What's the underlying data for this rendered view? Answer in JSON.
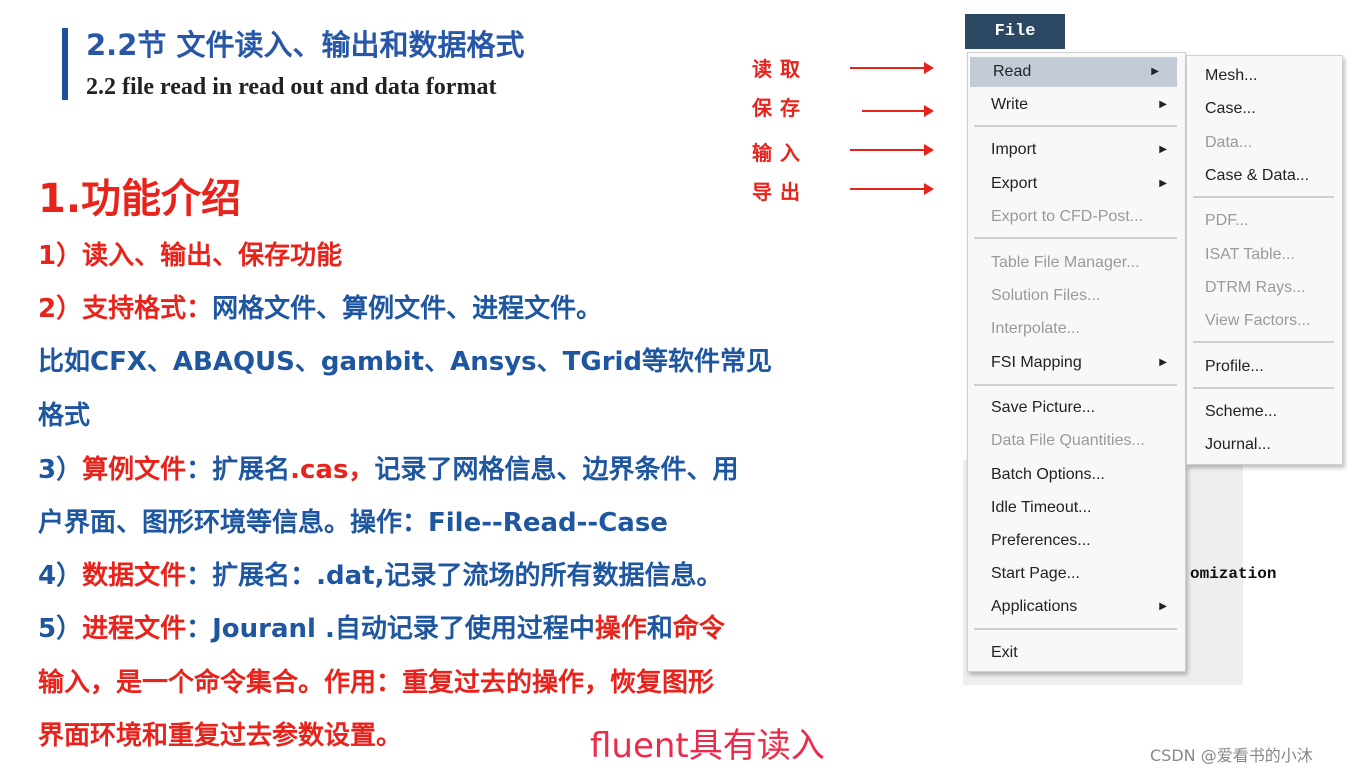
{
  "slide": {
    "title": "2.2节 文件读入、输出和数据格式",
    "subtitle": "2.2  file read in read out and data format",
    "heading": "1.功能介绍",
    "lines": [
      [
        "1）读入、输出、保存功能"
      ],
      [
        "2）支持格式：",
        "网格文件、算例文件、进程文件。"
      ],
      [
        "比如CFX、ABAQUS、gambit、Ansys、TGrid等软件常见"
      ],
      [
        "格式"
      ],
      [
        "3）",
        "算例文件",
        "：扩展名",
        ".cas，",
        "记录了网格信息、边界条件、用"
      ],
      [
        "户界面、图形环境等信息。操作：File--Read--Case"
      ],
      [
        "4）",
        "数据文件",
        "：扩展名：.dat,记录了流场的所有数据信息。"
      ],
      [
        "5）",
        "进程文件",
        "：Jouranl .自动记录了使用过程中",
        "操作",
        "和",
        "命令"
      ],
      [
        "输入，是一个命令集合。作用：重复过去的操作，恢复图形"
      ],
      [
        "界面环境和重复过去参数设置。"
      ]
    ],
    "caption": "fluent具有读入",
    "labels": [
      "读取",
      "保存",
      "输入",
      "导出"
    ],
    "watermark": "CSDN @爱看书的小沐",
    "background_text": "omization"
  },
  "menu": {
    "file_label": "File",
    "items": [
      {
        "label": "Read",
        "submenu": true,
        "highlighted": true
      },
      {
        "label": "Write",
        "submenu": true
      },
      {
        "label": "Import",
        "submenu": true
      },
      {
        "label": "Export",
        "submenu": true
      },
      {
        "label": "Export to CFD-Post...",
        "disabled": true
      },
      {
        "label": "Table File Manager...",
        "disabled": true
      },
      {
        "label": "Solution Files...",
        "disabled": true
      },
      {
        "label": "Interpolate...",
        "disabled": true
      },
      {
        "label": "FSI Mapping",
        "submenu": true
      },
      {
        "label": "Save Picture..."
      },
      {
        "label": "Data File Quantities...",
        "disabled": true
      },
      {
        "label": "Batch Options..."
      },
      {
        "label": "Idle Timeout..."
      },
      {
        "label": "Preferences..."
      },
      {
        "label": "Start Page..."
      },
      {
        "label": "Applications",
        "submenu": true
      },
      {
        "label": "Exit"
      }
    ],
    "read_submenu": [
      {
        "label": "Mesh..."
      },
      {
        "label": "Case..."
      },
      {
        "label": "Data...",
        "disabled": true
      },
      {
        "label": "Case & Data..."
      },
      {
        "label": "PDF...",
        "disabled": true
      },
      {
        "label": "ISAT Table...",
        "disabled": true
      },
      {
        "label": "DTRM Rays...",
        "disabled": true
      },
      {
        "label": "View Factors...",
        "disabled": true
      },
      {
        "label": "Profile..."
      },
      {
        "label": "Scheme..."
      },
      {
        "label": "Journal..."
      }
    ]
  },
  "colors": {
    "blue": "#1f56a0",
    "red": "#e8231c",
    "menu_highlight": "#c3ccd6",
    "file_button": "#2c4863"
  }
}
